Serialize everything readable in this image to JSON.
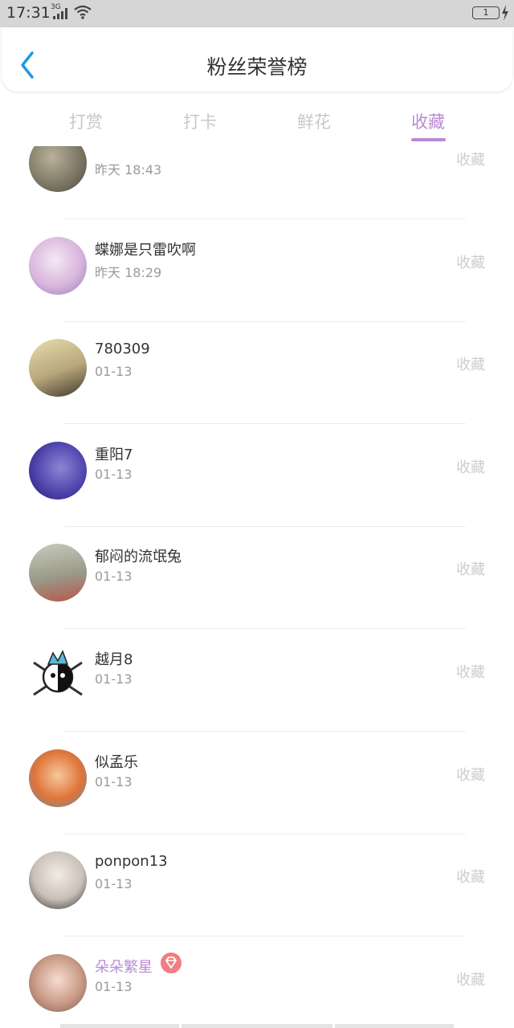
{
  "status_bar": {
    "time": "17:31",
    "network": "3G",
    "battery": "1"
  },
  "header": {
    "title": "粉丝荣誉榜"
  },
  "tabs": [
    {
      "label": "打赏",
      "active": false
    },
    {
      "label": "打卡",
      "active": false
    },
    {
      "label": "鲜花",
      "active": false
    },
    {
      "label": "收藏",
      "active": true
    }
  ],
  "list": [
    {
      "name": "",
      "date": "昨天 18:43",
      "action": "收藏"
    },
    {
      "name": "蝶娜是只雷吹啊",
      "date": "昨天 18:29",
      "action": "收藏"
    },
    {
      "name": "780309",
      "date": "01-13",
      "action": "收藏"
    },
    {
      "name": "重阳7",
      "date": "01-13",
      "action": "收藏"
    },
    {
      "name": "郁闷的流氓兔",
      "date": "01-13",
      "action": "收藏"
    },
    {
      "name": "越月8",
      "date": "01-13",
      "action": "收藏"
    },
    {
      "name": "似孟乐",
      "date": "01-13",
      "action": "收藏"
    },
    {
      "name": "ponpon13",
      "date": "01-13",
      "action": "收藏"
    },
    {
      "name": "朵朵繁星",
      "date": "01-13",
      "action": "收藏",
      "badge": "diamond-icon"
    }
  ],
  "colors": {
    "accent": "#b88ad6",
    "muted": "#cdcdcd",
    "badge": "#f07e82"
  }
}
